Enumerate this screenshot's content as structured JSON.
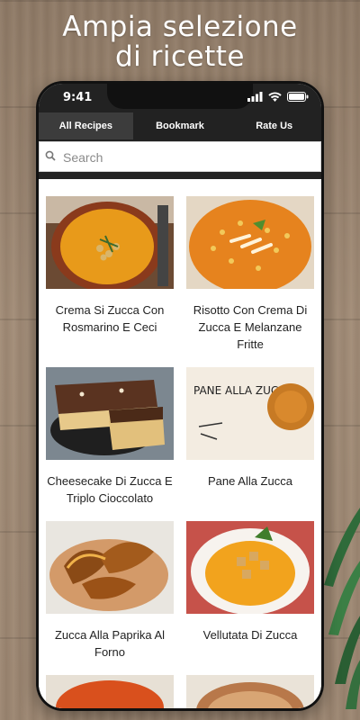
{
  "headline": {
    "line1": "Ampia selezione",
    "line2": "di ricette"
  },
  "status": {
    "time": "9:41"
  },
  "tabs": [
    {
      "label": "All Recipes",
      "active": true
    },
    {
      "label": "Bookmark",
      "active": false
    },
    {
      "label": "Rate Us",
      "active": false
    }
  ],
  "search": {
    "placeholder": "Search"
  },
  "recipes": [
    {
      "title": "Crema Si Zucca Con Rosmarino E Ceci"
    },
    {
      "title": "Risotto Con Crema Di Zucca E Melanzane Fritte"
    },
    {
      "title": "Cheesecake Di Zucca E Triplo Cioccolato"
    },
    {
      "title": "Pane Alla Zucca",
      "photo_text": "PANE ALLA ZUCCA"
    },
    {
      "title": "Zucca Alla Paprika Al Forno"
    },
    {
      "title": "Vellutata Di Zucca"
    }
  ],
  "colors": {
    "topbar": "#222222",
    "active_tab": "#3c3c3c",
    "accent_orange": "#e8a32a"
  }
}
